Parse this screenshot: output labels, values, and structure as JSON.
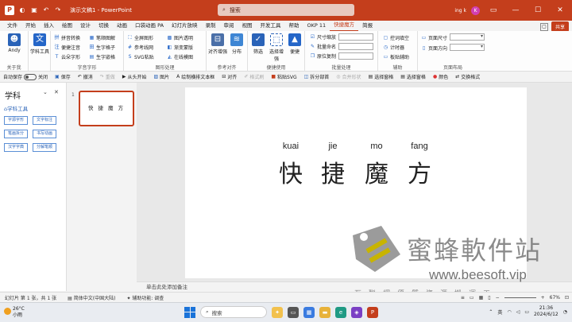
{
  "titlebar": {
    "app_title": "演示文稿1 - PowerPoint",
    "search_placeholder": "搜索",
    "user_name": "ing k",
    "avatar_initial": "K",
    "accent": "#c43e1c"
  },
  "menubar": {
    "items": [
      "文件",
      "开始",
      "插入",
      "绘图",
      "设计",
      "切换",
      "动画",
      "口袋动画 PA",
      "幻灯片放映",
      "录制",
      "审阅",
      "视图",
      "开发工具",
      "帮助",
      "OKP 11",
      "快捷魔方",
      "简报"
    ],
    "active_index": 15,
    "share_label": "共享"
  },
  "ribbon": {
    "about": {
      "label": "Andy",
      "group": "关于我"
    },
    "subject": {
      "label": "学科工具"
    },
    "pinyin": {
      "items": [
        "拼音转换",
        "笔顺图解",
        "便捷注音",
        "生字格子",
        "云朵字形",
        "生字嵌格"
      ],
      "group": "字音字形"
    },
    "graphics": {
      "items": [
        "全屏图形",
        "图片透明",
        "参考线网",
        "渐变蒙版",
        "SVG粘贴",
        "在线模图"
      ],
      "group": "图形处理"
    },
    "align": {
      "labels": [
        "对齐增强",
        "分布"
      ],
      "group": "参考对齐"
    },
    "select": {
      "labels": [
        "筛选",
        "选择增强",
        "便捷"
      ],
      "group": "便捷使用"
    },
    "batch": {
      "items": [
        "尺寸缩放",
        "批量命名",
        "原位复制"
      ],
      "group": "批量处理"
    },
    "assist": {
      "items": [
        "控词填空",
        "计时器",
        "板贴辅助"
      ],
      "group": "辅助"
    },
    "layout": {
      "items": [
        "页面尺寸",
        "页面方向"
      ],
      "group": "页面布局"
    }
  },
  "qat": {
    "autosave": "自动保存",
    "autosave_state": "关闭",
    "items": [
      "保存",
      "撤消",
      "重做",
      "从头开始",
      "图片",
      "绘制横排文本框",
      "对齐",
      "格式刷",
      "粘贴SVG",
      "拆分部首",
      "合并形状",
      "选择窗格",
      "选择窗格",
      "颜色",
      "交换格式"
    ]
  },
  "sidepanel": {
    "title": "学科",
    "subtitle": "学科工具",
    "buttons": [
      "字源字形",
      "文字标注",
      "笔画拆分",
      "书写动画",
      "汉字字典",
      "分解笔顺"
    ]
  },
  "slides": {
    "number": "1",
    "thumb_text": "快 捷 魔 方"
  },
  "slide": {
    "pinyin": [
      "kuai",
      "jie",
      "mo",
      "fang"
    ],
    "hanzi": [
      "快",
      "捷",
      "魔",
      "方"
    ]
  },
  "notes": {
    "placeholder": "单击此处添加备注"
  },
  "watermark": {
    "name": "蜜蜂軟件站",
    "url": "www.beesoft.vip",
    "tagline": "互聯網優質資源搬運工"
  },
  "statusbar": {
    "slide_info": "幻灯片 第 1 张，共 1 张",
    "language": "简体中文(中国大陆)",
    "accessibility": "辅助功能: 调查",
    "zoom": "67%"
  },
  "taskbar": {
    "temperature": "26°C",
    "weather": "小雨",
    "search_label": "搜索",
    "ime": "英",
    "time": "21:36",
    "date": "2024/6/12"
  }
}
